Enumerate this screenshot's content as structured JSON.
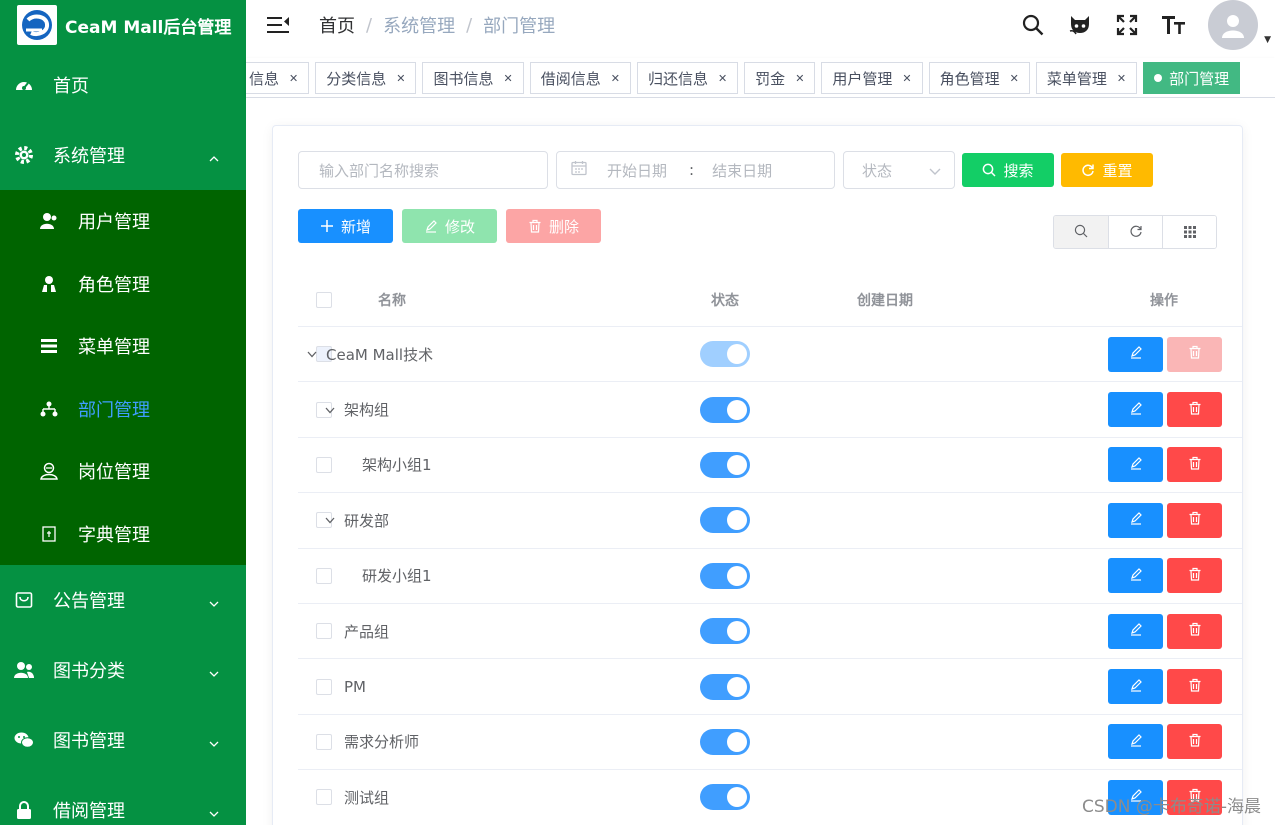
{
  "brand": {
    "name": "CeaM Mall后台管理",
    "color": "#059142"
  },
  "sidebar": {
    "items": [
      {
        "label": "首页",
        "icon": "dashboard-icon"
      },
      {
        "label": "系统管理",
        "icon": "gear-icon",
        "expanded": true
      }
    ],
    "system_sub": [
      {
        "label": "用户管理",
        "icon": "user-icon"
      },
      {
        "label": "角色管理",
        "icon": "role-icon"
      },
      {
        "label": "菜单管理",
        "icon": "list-icon"
      },
      {
        "label": "部门管理",
        "icon": "tree-icon",
        "active": true
      },
      {
        "label": "岗位管理",
        "icon": "post-icon"
      },
      {
        "label": "字典管理",
        "icon": "dict-icon"
      }
    ],
    "more": [
      {
        "label": "公告管理",
        "icon": "notice-icon"
      },
      {
        "label": "图书分类",
        "icon": "people-icon"
      },
      {
        "label": "图书管理",
        "icon": "wechat-icon"
      },
      {
        "label": "借阅管理",
        "icon": "lock-icon"
      }
    ]
  },
  "header": {
    "breadcrumb": [
      "首页",
      "系统管理",
      "部门管理"
    ]
  },
  "tags": [
    {
      "label": "信息"
    },
    {
      "label": "分类信息"
    },
    {
      "label": "图书信息"
    },
    {
      "label": "借阅信息"
    },
    {
      "label": "归还信息"
    },
    {
      "label": "罚金"
    },
    {
      "label": "用户管理"
    },
    {
      "label": "角色管理"
    },
    {
      "label": "菜单管理"
    },
    {
      "label": "部门管理",
      "active": true
    }
  ],
  "search": {
    "name_placeholder": "输入部门名称搜索",
    "start_placeholder": "开始日期",
    "range_sep": ":",
    "end_placeholder": "结束日期",
    "status_placeholder": "状态",
    "search_label": "搜索",
    "reset_label": "重置"
  },
  "actions": {
    "add_label": "新增",
    "edit_label": "修改",
    "delete_label": "删除"
  },
  "table": {
    "headers": {
      "name": "名称",
      "status": "状态",
      "created": "创建日期",
      "ops": "操作"
    },
    "rows": [
      {
        "name": "CeaM Mall技术",
        "level": 0,
        "expandable": true,
        "enabled": true,
        "root": true
      },
      {
        "name": "架构组",
        "level": 1,
        "expandable": true,
        "enabled": true
      },
      {
        "name": "架构小组1",
        "level": 2,
        "expandable": false,
        "enabled": true
      },
      {
        "name": "研发部",
        "level": 1,
        "expandable": true,
        "enabled": true
      },
      {
        "name": "研发小组1",
        "level": 2,
        "expandable": false,
        "enabled": true
      },
      {
        "name": "产品组",
        "level": 1,
        "expandable": false,
        "enabled": true
      },
      {
        "name": "PM",
        "level": 1,
        "expandable": false,
        "enabled": true
      },
      {
        "name": "需求分析师",
        "level": 1,
        "expandable": false,
        "enabled": true
      },
      {
        "name": "测试组",
        "level": 1,
        "expandable": false,
        "enabled": true
      }
    ]
  },
  "watermark": "CSDN @卡布奇诺-海晨",
  "colors": {
    "primary": "#1890ff",
    "success": "#13ce66",
    "warning": "#ffba00",
    "danger": "#ff4949",
    "tag_active": "#42b983"
  }
}
